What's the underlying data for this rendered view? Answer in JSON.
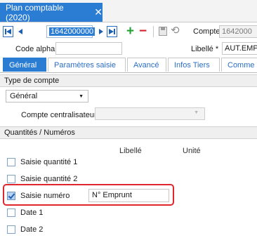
{
  "window": {
    "tab_title": "Plan comptable (2020)"
  },
  "toolbar": {
    "code_value": "1642000000",
    "compte_label": "Compte",
    "compte_value": "1642000"
  },
  "header_fields": {
    "code_alpha_label": "Code alpha",
    "libelle_label": "Libellé *",
    "libelle_value": "AUT.EMPR"
  },
  "subtabs": [
    "Général",
    "Paramètres saisie",
    "Avancé",
    "Infos Tiers",
    "Comme"
  ],
  "type_compte": {
    "section_title": "Type de compte",
    "selected": "Général",
    "centralisateur_label": "Compte centralisateur"
  },
  "quantites": {
    "section_title": "Quantités / Numéros",
    "col_libelle": "Libellé",
    "col_unite": "Unité",
    "rows": [
      {
        "label": "Saisie quantité 1",
        "checked": false
      },
      {
        "label": "Saisie quantité 2",
        "checked": false
      },
      {
        "label": "Saisie numéro",
        "checked": true,
        "value": "N° Emprunt"
      },
      {
        "label": "Date 1",
        "checked": false
      },
      {
        "label": "Date 2",
        "checked": false
      }
    ]
  },
  "colors": {
    "accent": "#2b7cd3",
    "highlight": "#e0262d",
    "add": "#22a230",
    "remove": "#d21f2a"
  }
}
